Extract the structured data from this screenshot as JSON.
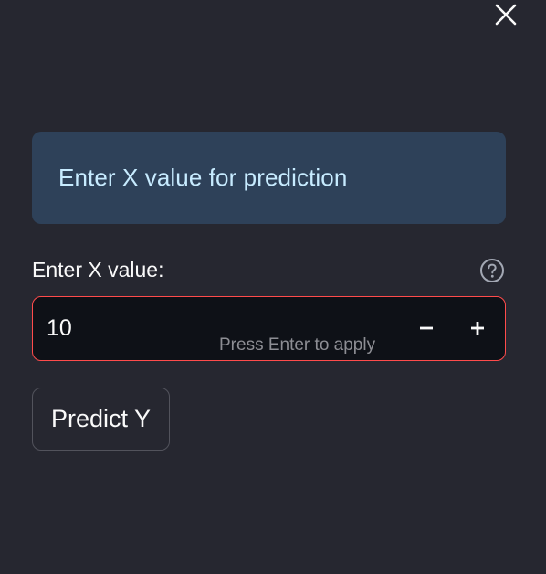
{
  "dialog": {
    "close_icon": "close-icon",
    "info_message": "Enter X value for prediction",
    "info_color": "#c7ebff",
    "info_bg": "#2e4159"
  },
  "x_input": {
    "label": "Enter X value:",
    "help_icon": "question-circle-icon",
    "value": "10",
    "hint": "Press Enter to apply",
    "decrement_icon": "minus-icon",
    "increment_icon": "plus-icon",
    "focus_border_color": "#ff4b4b"
  },
  "predict_button": {
    "label": "Predict Y"
  },
  "theme": {
    "background": "#262730",
    "input_background": "#0e1117",
    "text": "#fafafa"
  }
}
